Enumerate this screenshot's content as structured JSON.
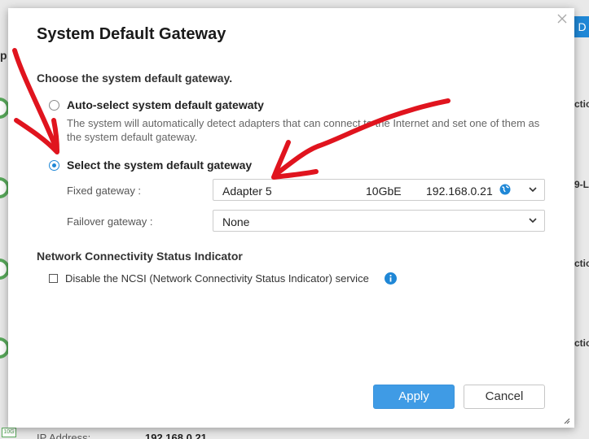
{
  "background": {
    "button_label": "m D",
    "snippets": [
      "ctio",
      "9-L",
      "ctio",
      "ctio"
    ],
    "left_letter": "p",
    "tag_text": "10G",
    "ip_label": "IP Address:",
    "ip_value": "192.168.0.21"
  },
  "dialog": {
    "title": "System Default Gateway",
    "section_heading": "Choose the system default gateway.",
    "auto_option": {
      "label": "Auto-select system default gatewaty",
      "description": "The system will automatically detect adapters that can connect to the Internet and set one of them as the system default gateway.",
      "selected": false
    },
    "manual_option": {
      "label": "Select the system default gateway",
      "selected": true
    },
    "fixed_gateway": {
      "label": "Fixed gateway :",
      "adapter": "Adapter 5",
      "speed": "10GbE",
      "ip": "192.168.0.21"
    },
    "failover_gateway": {
      "label": "Failover gateway :",
      "value": "None"
    },
    "ncsi": {
      "heading": "Network Connectivity Status Indicator",
      "checkbox_label": "Disable the NCSI (Network Connectivity Status Indicator) service",
      "checked": false
    },
    "buttons": {
      "apply": "Apply",
      "cancel": "Cancel"
    }
  },
  "colors": {
    "accent": "#1f87d6",
    "apply_button": "#3f9be5",
    "annotation": "#e0141e",
    "status_green": "#58a85a"
  },
  "icons": [
    "close-icon",
    "chevron-down-icon",
    "globe-icon",
    "info-icon",
    "resize-grip-icon"
  ]
}
